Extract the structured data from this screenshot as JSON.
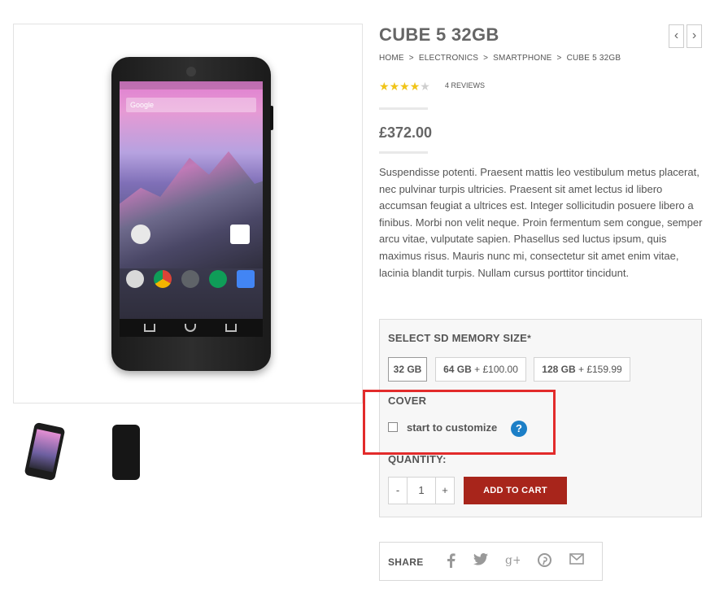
{
  "product": {
    "title": "CUBE 5 32GB",
    "breadcrumb": [
      "HOME",
      ">",
      "ELECTRONICS",
      ">",
      "SMARTPHONE",
      ">",
      "CUBE 5 32GB"
    ],
    "rating": 4,
    "rating_max": 5,
    "reviews_label": "4 REVIEWS",
    "price": "£372.00",
    "description": "Suspendisse potenti. Praesent mattis leo vestibulum metus placerat, nec pulvinar turpis ultricies. Praesent sit amet lectus id libero accumsan feugiat a ultrices est. Integer sollicitudin posuere libero a finibus. Morbi non velit neque. Proin fermentum sem congue, semper arcu vitae, vulputate sapien. Phasellus sed luctus ipsum, quis maximus risus. Mauris nunc mi, consectetur sit amet enim vitae, lacinia blandit turpis. Nullam cursus porttitor tincidunt."
  },
  "gallery": {
    "main_image": "phone-front-image",
    "thumbnails": [
      "phone-front-thumbnail",
      "phone-back-thumbnail"
    ],
    "screen_search_text": "Google"
  },
  "nav": {
    "prev_icon": "‹",
    "next_icon": "›"
  },
  "options": {
    "sd_label": "SELECT SD MEMORY SIZE",
    "required_mark": "*",
    "sizes": [
      {
        "name": "32 GB",
        "extra": ""
      },
      {
        "name": "64 GB",
        "extra": " + £100.00"
      },
      {
        "name": "128 GB",
        "extra": " + £159.99"
      }
    ],
    "selected_size": "32 GB",
    "cover_label": "COVER",
    "customize_label": "start to customize",
    "customize_checked": false,
    "help_icon": "?",
    "quantity_label": "QUANTITY:",
    "quantity_value": "1",
    "minus": "-",
    "plus": "+",
    "add_to_cart": "ADD TO CART"
  },
  "share": {
    "label": "SHARE",
    "icons": [
      "facebook-icon",
      "twitter-icon",
      "google-plus-icon",
      "pinterest-icon",
      "email-icon"
    ]
  },
  "colors": {
    "accent": "#a8251b",
    "highlight": "#e22b2b",
    "help": "#1c7fc7",
    "star": "#f0c419"
  }
}
